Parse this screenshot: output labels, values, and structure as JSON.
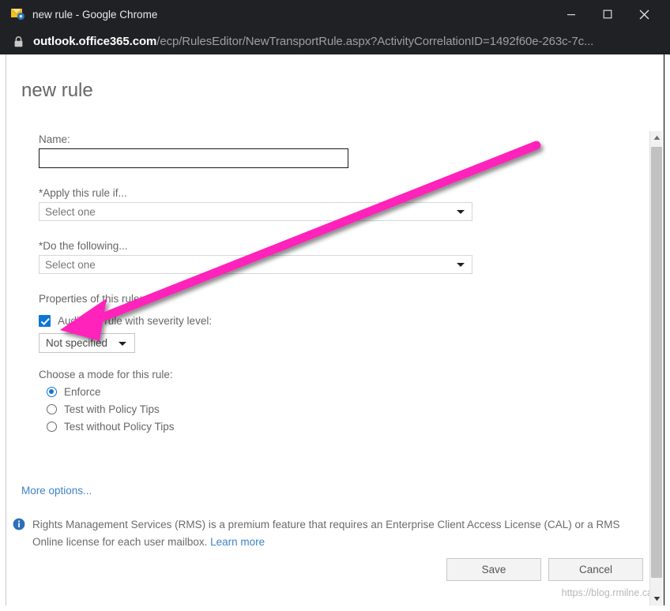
{
  "browser": {
    "title": "new rule - Google Chrome",
    "favicon": "mail-rule-icon",
    "window_controls": {
      "minimize": "minimize-icon",
      "maximize": "maximize-icon",
      "close": "close-icon"
    },
    "address_bar": {
      "lock": "lock-icon",
      "host": "outlook.office365.com",
      "path": "/ecp/RulesEditor/NewTransportRule.aspx?ActivityCorrelationID=1492f60e-263c-7c...",
      "full_url": "outlook.office365.com/ecp/RulesEditor/NewTransportRule.aspx?ActivityCorrelationID=1492f60e-263c-7c..."
    }
  },
  "page": {
    "title": "new rule",
    "name_field": {
      "label": "Name:",
      "value": "",
      "placeholder": ""
    },
    "apply_if": {
      "label": "*Apply this rule if...",
      "selected": "Select one"
    },
    "do_following": {
      "label": "*Do the following...",
      "selected": "Select one"
    },
    "properties": {
      "label": "Properties of this rule:",
      "audit_checkbox": {
        "label": "Audit this rule with severity level:",
        "checked": true
      },
      "severity": {
        "selected": "Not specified"
      }
    },
    "mode": {
      "label": "Choose a mode for this rule:",
      "options": [
        {
          "label": "Enforce",
          "selected": true
        },
        {
          "label": "Test with Policy Tips",
          "selected": false
        },
        {
          "label": "Test without Policy Tips",
          "selected": false
        }
      ]
    },
    "more_options_link": "More options...",
    "info_notice": {
      "icon": "info-icon",
      "text": "Rights Management Services (RMS) is a premium feature that requires an Enterprise Client Access License (CAL) or a RMS Online license for each user mailbox. ",
      "link_text": "Learn more"
    },
    "buttons": {
      "save": "Save",
      "cancel": "Cancel"
    },
    "watermark": "https://blog.rmilne.ca"
  },
  "scrollbar": {
    "up_arrow": "scroll-up-icon",
    "down_arrow": "scroll-down-icon"
  },
  "annotation": {
    "type": "arrow",
    "color": "#FF22BB",
    "points_to": "audit-checkbox"
  },
  "colors": {
    "accent_blue": "#0f75d4",
    "link_blue": "#3d83c9",
    "chrome_dark": "#202124",
    "annotation_pink": "#FF22BB"
  }
}
